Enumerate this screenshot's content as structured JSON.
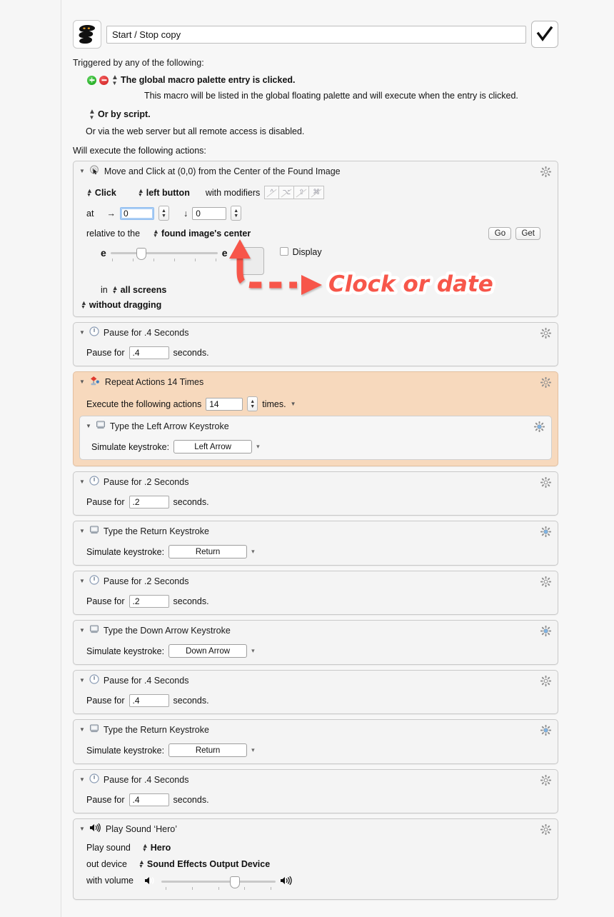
{
  "header": {
    "macro_icon": "keyboard-maestro-logo",
    "macro_name": "Start / Stop copy",
    "enabled_icon": "checkmark-icon"
  },
  "triggers": {
    "section_label": "Triggered by any of the following:",
    "add_icon": "add-trigger-icon",
    "remove_icon": "remove-trigger-icon",
    "primary": "The global macro palette entry is clicked.",
    "description": "This macro will be listed in the global floating palette and will execute when the entry is clicked.",
    "or_script": "Or by script.",
    "web_server": "Or via the web server but all remote access is disabled."
  },
  "actions_label": "Will execute the following actions:",
  "annotation": {
    "text": "Clock or date",
    "color": "#f7564a",
    "arrow_icon": "dashed-arrow-icon"
  },
  "actions": [
    {
      "id": "move-and-click",
      "title": "Move and Click at (0,0) from the Center of the Found Image",
      "icon": "mouse-pointer-icon",
      "gear_icon": "gear-icon",
      "click_mode": "Click",
      "button": "left button",
      "modifiers_label": "with modifiers",
      "modifier_keys": [
        "^",
        "⌥",
        "⇧",
        "⌘"
      ],
      "at_label": "at",
      "x_arrow": "→",
      "x_value": "0",
      "y_arrow": "↓",
      "y_value": "0",
      "relative_label": "relative to the",
      "relative_value": "found image's center",
      "go_button": "Go",
      "get_button": "Get",
      "fuzz_left": "e",
      "fuzz_right": "e",
      "image_well_icon": "image-well",
      "display_label": "Display",
      "display_checked": false,
      "in_label": "in",
      "screens_value": "all screens",
      "drag_value": "without dragging"
    },
    {
      "id": "pause-1",
      "title": "Pause for .4 Seconds",
      "icon": "clock-icon",
      "gear_icon": "gear-icon",
      "prefix": "Pause for",
      "value": ".4",
      "suffix": "seconds."
    },
    {
      "id": "repeat",
      "title": "Repeat Actions 14 Times",
      "icon": "repeat-icon",
      "gear_icon": "gear-icon",
      "highlight": true,
      "prefix": "Execute the following actions",
      "count": "14",
      "suffix": "times.",
      "menu_icon": "chevron-down-icon",
      "child": {
        "id": "type-left-arrow",
        "title": "Type the Left Arrow Keystroke",
        "icon": "keyboard-icon",
        "gear_icon": "gear-icon-blue",
        "label": "Simulate keystroke:",
        "keystroke": "Left Arrow",
        "chevron_icon": "chevron-down-icon"
      }
    },
    {
      "id": "pause-2",
      "title": "Pause for .2 Seconds",
      "icon": "clock-icon",
      "gear_icon": "gear-icon",
      "prefix": "Pause for",
      "value": ".2",
      "suffix": "seconds."
    },
    {
      "id": "type-return-1",
      "title": "Type the Return Keystroke",
      "icon": "keyboard-icon",
      "gear_icon": "gear-icon-blue",
      "label": "Simulate keystroke:",
      "keystroke": "Return",
      "chevron_icon": "chevron-down-icon"
    },
    {
      "id": "pause-3",
      "title": "Pause for .2 Seconds",
      "icon": "clock-icon",
      "gear_icon": "gear-icon",
      "prefix": "Pause for",
      "value": ".2",
      "suffix": "seconds."
    },
    {
      "id": "type-down-arrow",
      "title": "Type the Down Arrow Keystroke",
      "icon": "keyboard-icon",
      "gear_icon": "gear-icon-blue",
      "label": "Simulate keystroke:",
      "keystroke": "Down Arrow",
      "chevron_icon": "chevron-down-icon"
    },
    {
      "id": "pause-4",
      "title": "Pause for .4 Seconds",
      "icon": "clock-icon",
      "gear_icon": "gear-icon",
      "prefix": "Pause for",
      "value": ".4",
      "suffix": "seconds."
    },
    {
      "id": "type-return-2",
      "title": "Type the Return Keystroke",
      "icon": "keyboard-icon",
      "gear_icon": "gear-icon-blue",
      "label": "Simulate keystroke:",
      "keystroke": "Return",
      "chevron_icon": "chevron-down-icon"
    },
    {
      "id": "pause-5",
      "title": "Pause for .4 Seconds",
      "icon": "clock-icon",
      "gear_icon": "gear-icon",
      "prefix": "Pause for",
      "value": ".4",
      "suffix": "seconds."
    },
    {
      "id": "play-sound",
      "title": "Play Sound ‘Hero’",
      "icon": "speaker-icon",
      "gear_icon": "gear-icon",
      "sound_label": "Play sound",
      "sound_value": "Hero",
      "device_label": "out device",
      "device_value": "Sound Effects Output Device",
      "volume_label": "with volume",
      "volume_low_icon": "speaker-low-icon",
      "volume_high_icon": "speaker-high-icon"
    }
  ]
}
